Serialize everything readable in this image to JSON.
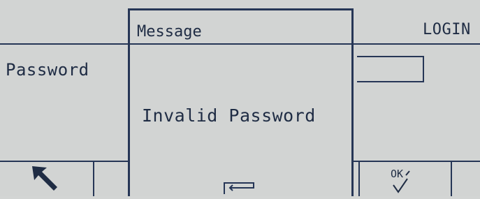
{
  "screen": {
    "title": "LOGIN"
  },
  "form": {
    "password_label": "Password"
  },
  "softkeys": {
    "back_icon": "arrow-up-left-icon",
    "ok_label": "OK",
    "ok_icon": "checkmark-icon"
  },
  "dialog": {
    "title": "Message",
    "message": "Invalid Password",
    "confirm_icon": "enter-key-icon"
  },
  "colors": {
    "background": "#d2d4d3",
    "ink": "#263656",
    "text": "#1f2c44"
  }
}
